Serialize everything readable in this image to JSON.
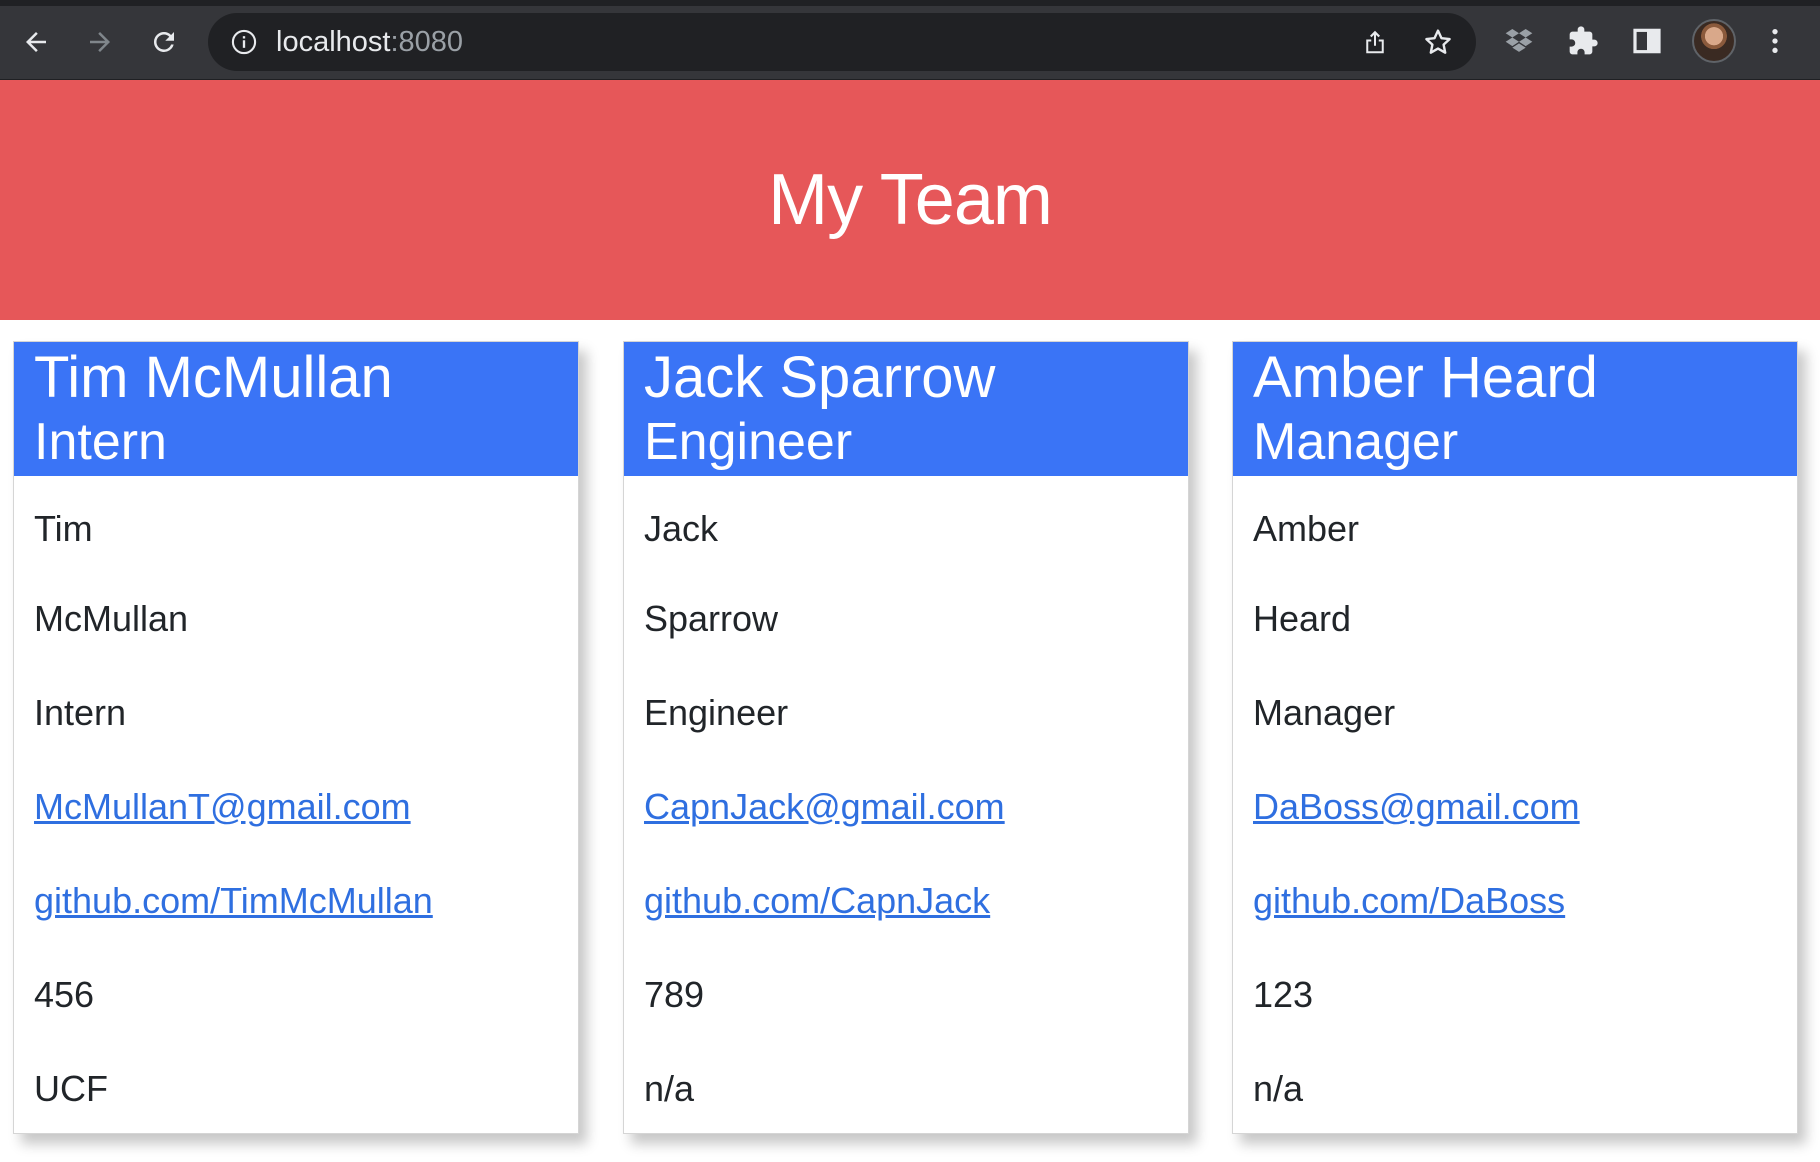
{
  "browser": {
    "url_host": "localhost",
    "url_port": ":8080"
  },
  "page": {
    "title": "My Team"
  },
  "employees": [
    {
      "name": "Tim McMullan",
      "role": "Intern",
      "first": "Tim",
      "last": "McMullan",
      "role_text": "Intern",
      "email": "McMullanT@gmail.com",
      "github": "github.com/TimMcMullan",
      "id": "456",
      "extra": "UCF"
    },
    {
      "name": "Jack Sparrow",
      "role": "Engineer",
      "first": "Jack",
      "last": "Sparrow",
      "role_text": "Engineer",
      "email": "CapnJack@gmail.com",
      "github": "github.com/CapnJack",
      "id": "789",
      "extra": "n/a"
    },
    {
      "name": "Amber Heard",
      "role": "Manager",
      "first": "Amber",
      "last": "Heard",
      "role_text": "Manager",
      "email": "DaBoss@gmail.com",
      "github": "github.com/DaBoss",
      "id": "123",
      "extra": "n/a"
    }
  ],
  "colors": {
    "hero": "#e65759",
    "card_header": "#3a74f6",
    "link": "#2f6fe0"
  }
}
